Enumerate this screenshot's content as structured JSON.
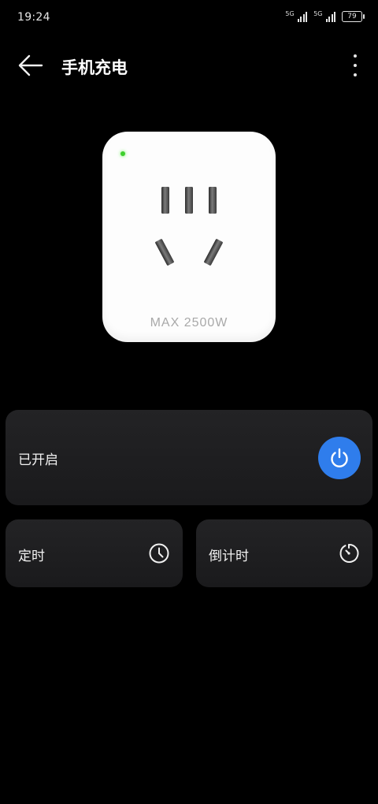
{
  "status_bar": {
    "time": "19:24",
    "signal_1_label": "5G",
    "signal_2_label": "5G",
    "battery": "79"
  },
  "header": {
    "title": "手机充电"
  },
  "device": {
    "max_label": "MAX  2500W",
    "led_color": "#3ecf2d",
    "icon": "power-socket-icon"
  },
  "controls": {
    "power_label": "已开启",
    "power_state": "on",
    "timer_label": "定时",
    "countdown_label": "倒计时"
  },
  "colors": {
    "accent": "#2f7dec",
    "card_bg": "#1e1e20"
  }
}
